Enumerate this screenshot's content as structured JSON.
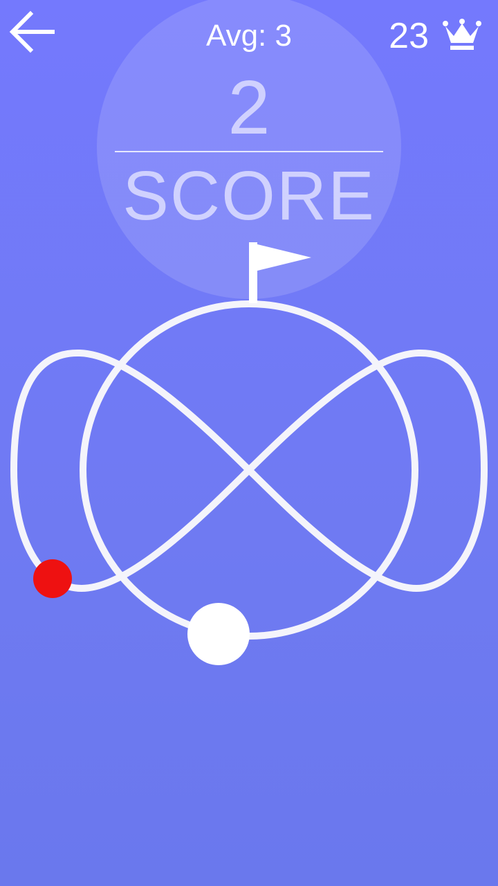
{
  "header": {
    "avg_label": "Avg: 3",
    "best_score": "23"
  },
  "scoreboard": {
    "score": "2",
    "label": "SCORE"
  },
  "colors": {
    "background_top": "#7479fd",
    "background_bottom": "#6a78ed",
    "track": "#ffffff",
    "player_ball": "#ffffff",
    "enemy_ball": "#ee1111"
  },
  "icons": {
    "back": "arrow-left-icon",
    "best": "crown-icon",
    "goal": "flag-icon"
  }
}
